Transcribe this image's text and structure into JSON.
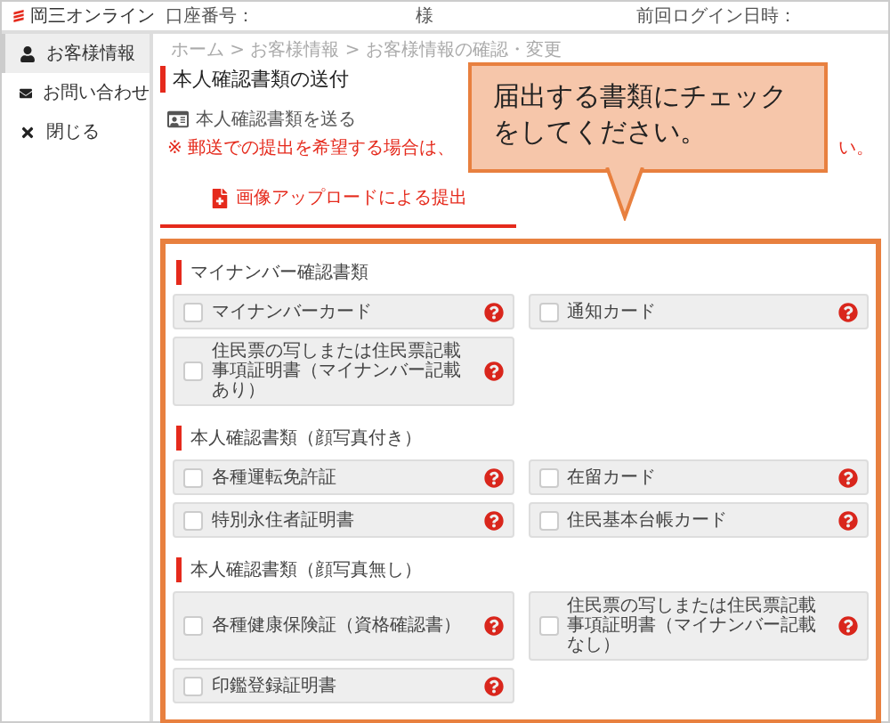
{
  "header": {
    "logo": "岡三オンライン",
    "account_label": "口座番号：",
    "honorific": "様",
    "last_login_label": "前回ログイン日時："
  },
  "sidebar": {
    "items": [
      {
        "label": "お客様情報",
        "selected": true
      },
      {
        "label": "お問い合わせ",
        "selected": false
      },
      {
        "label": "閉じる",
        "selected": false
      }
    ]
  },
  "breadcrumb": "ホーム > お客様情報 > お客様情報の確認・変更",
  "page_title": "本人確認書類の送付",
  "section_title": "本人確認書類を送る",
  "notice_start": "※ 郵送での提出を希望する場合は、",
  "notice_end": "い。",
  "tabs": [
    {
      "label": "画像アップロードによる提出",
      "selected": true
    }
  ],
  "callout": {
    "text": "届出する書類にチェックをしてください。"
  },
  "groups": [
    {
      "title": "マイナンバー確認書類",
      "items": [
        {
          "label": "マイナンバーカード",
          "checked": false
        },
        {
          "label": "通知カード",
          "checked": false
        },
        {
          "label": "住民票の写しまたは住民票記載事項証明書（マイナンバー記載あり）",
          "checked": false
        }
      ]
    },
    {
      "title": "本人確認書類（顔写真付き）",
      "items": [
        {
          "label": "各種運転免許証",
          "checked": false
        },
        {
          "label": "在留カード",
          "checked": false
        },
        {
          "label": "特別永住者証明書",
          "checked": false
        },
        {
          "label": "住民基本台帳カード",
          "checked": false
        }
      ]
    },
    {
      "title": "本人確認書類（顔写真無し）",
      "items": [
        {
          "label": "各種健康保険証（資格確認書）",
          "checked": false
        },
        {
          "label": "住民票の写しまたは住民票記載事項証明書（マイナンバー記載なし）",
          "checked": false
        },
        {
          "label": "印鑑登録証明書",
          "checked": false
        }
      ]
    }
  ]
}
